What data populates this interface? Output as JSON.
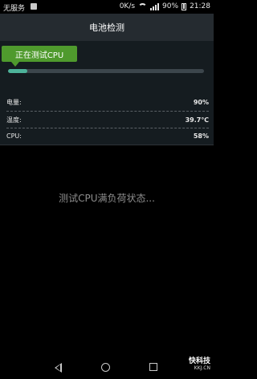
{
  "status_bar": {
    "carrier": "无服务",
    "speed": "0K/s",
    "battery": "90%",
    "time": "21:28"
  },
  "title": "电池检测",
  "testing_badge": "正在测试CPU",
  "progress": 0.1,
  "stats": [
    {
      "label": "电量:",
      "value": "90%"
    },
    {
      "label": "温度:",
      "value": "39.7℃"
    },
    {
      "label": "CPU:",
      "value": "58%"
    }
  ],
  "center_message": "测试CPU满负荷状态...",
  "watermark": {
    "brand": "快科技",
    "site": "KKJ.CN"
  },
  "icons": {
    "nav_back": "back-triangle-icon",
    "nav_home": "home-circle-icon",
    "nav_recent": "recent-square-icon"
  },
  "colors": {
    "title_bg": "#252b30",
    "panel_bg": "#151c20",
    "badge": "#4f9a2d",
    "progress": "#4db39a"
  }
}
